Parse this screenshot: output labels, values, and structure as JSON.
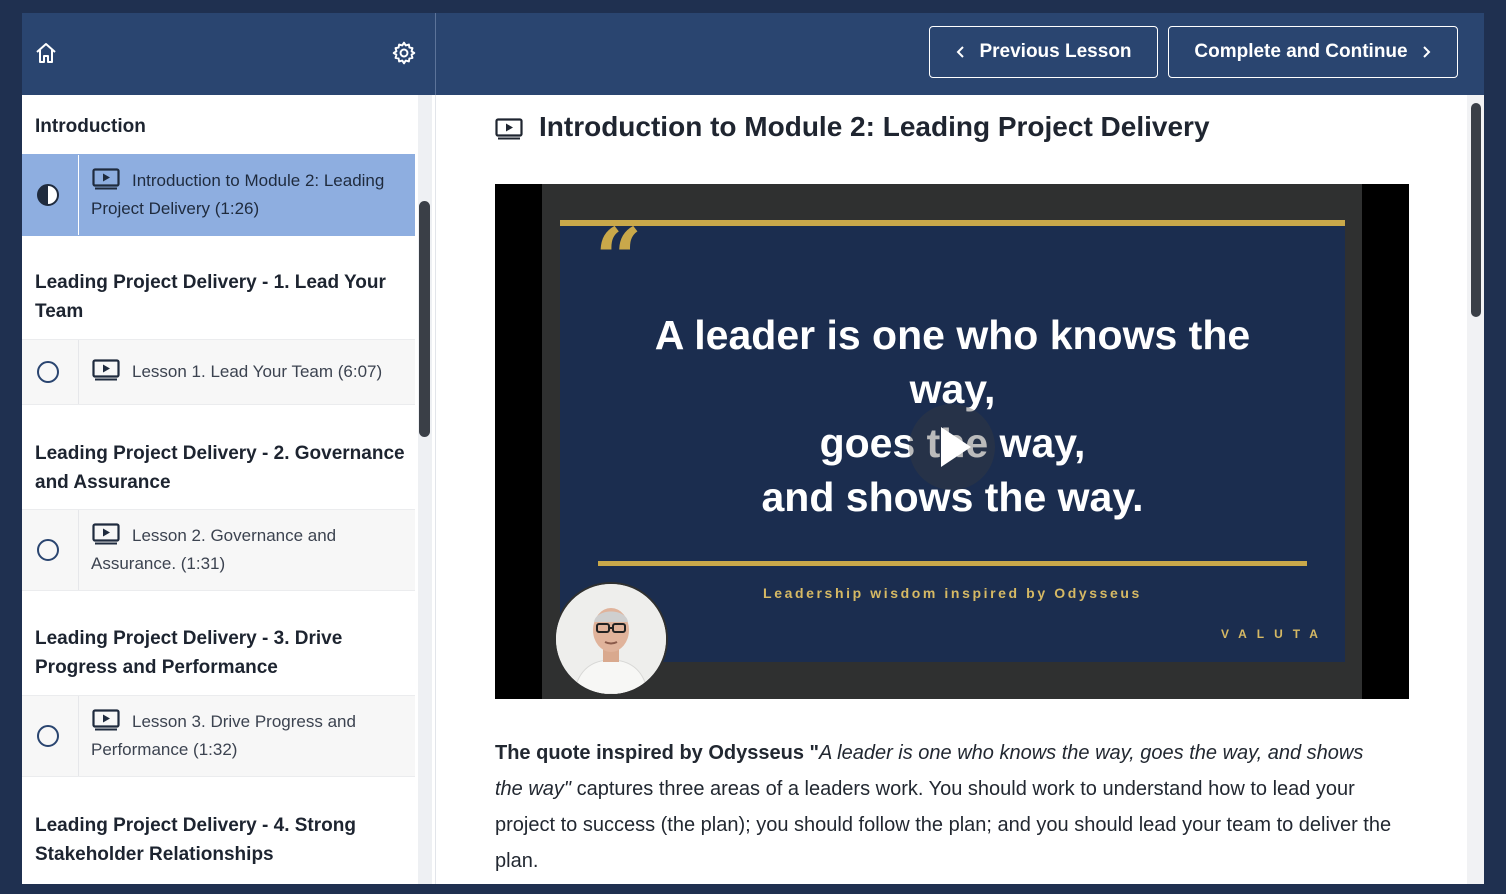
{
  "header": {
    "prev_label": "Previous Lesson",
    "next_label": "Complete and Continue"
  },
  "sidebar": {
    "sections": [
      {
        "title": "Introduction",
        "lessons": [
          {
            "label": "Introduction to Module 2: Leading Project Delivery (1:26)",
            "status": "in-progress",
            "active": true
          }
        ]
      },
      {
        "title": "Leading Project Delivery - 1. Lead Your Team",
        "lessons": [
          {
            "label": "Lesson 1. Lead Your Team (6:07)",
            "status": "not-started"
          }
        ]
      },
      {
        "title": "Leading Project Delivery - 2. Governance and Assurance",
        "lessons": [
          {
            "label": "Lesson 2. Governance and Assurance. (1:31)",
            "status": "not-started"
          }
        ]
      },
      {
        "title": "Leading Project Delivery - 3. Drive Progress and Performance",
        "lessons": [
          {
            "label": "Lesson 3. Drive Progress and Performance (1:32)",
            "status": "not-started"
          }
        ]
      },
      {
        "title": "Leading Project Delivery - 4. Strong Stakeholder Relationships",
        "lessons": []
      }
    ]
  },
  "main": {
    "title": "Introduction to Module 2: Leading Project Delivery",
    "video": {
      "quote_mark": "“",
      "quote_lines": [
        "A leader is one who knows the",
        "way,",
        "goes the way,",
        "and shows the way."
      ],
      "subtitle": "Leadership wisdom inspired by Odysseus",
      "brand": "VALUTA"
    },
    "paragraph": {
      "lead": "The quote inspired by Odysseus \"",
      "quote": "A leader is one who knows the way, goes the way, and shows the way\"",
      "rest": " captures three areas of a leaders work. You should work to understand how to lead your project to success (the plan); you should follow the plan; and you should lead your team to deliver the plan."
    }
  },
  "colors": {
    "header_bg": "#2a4570",
    "active_lesson_bg": "#8eaee0",
    "slide_bg": "#1b2d4f",
    "gold_accent": "#c9a84a"
  }
}
